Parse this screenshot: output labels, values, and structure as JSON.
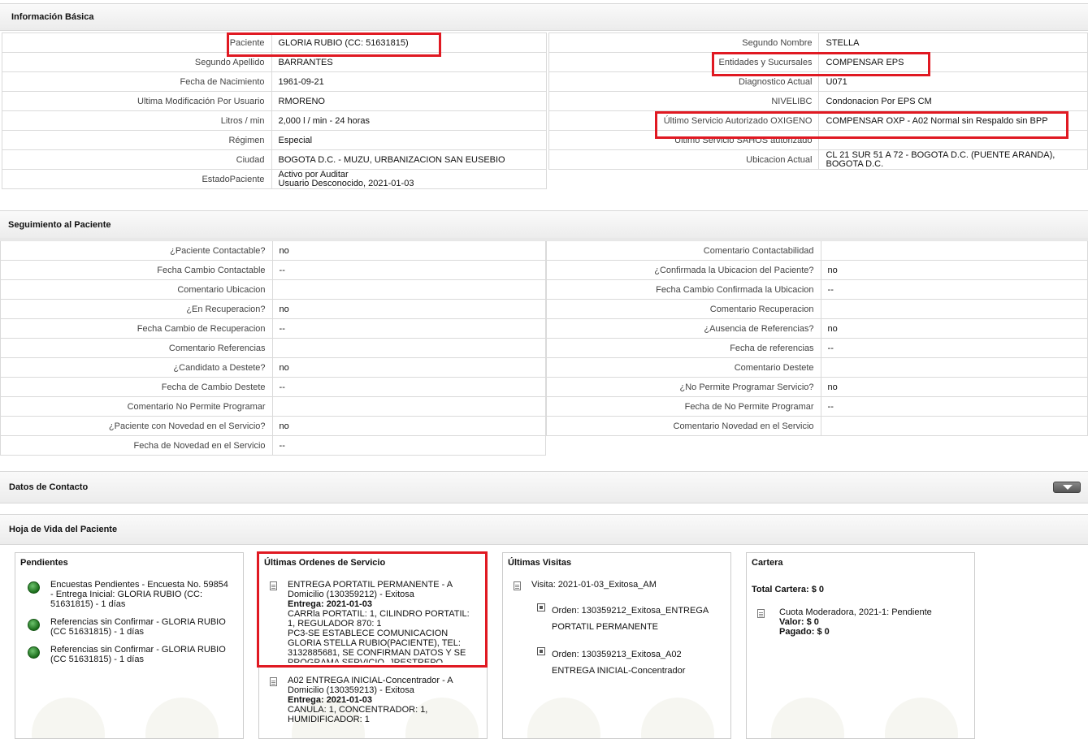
{
  "info_basica": {
    "title": "Información Básica",
    "left": [
      {
        "label": "Paciente",
        "value": "GLORIA RUBIO (CC: 51631815)"
      },
      {
        "label": "Segundo Apellido",
        "value": "BARRANTES"
      },
      {
        "label": "Fecha de Nacimiento",
        "value": "1961-09-21"
      },
      {
        "label": "Ultima Modificación Por Usuario",
        "value": "RMORENO"
      },
      {
        "label": "Litros / min",
        "value": "2,000 l / min - 24 horas"
      },
      {
        "label": "Régimen",
        "value": "Especial"
      },
      {
        "label": "Ciudad",
        "value": "BOGOTA D.C. - MUZU, URBANIZACION SAN EUSEBIO"
      },
      {
        "label": "EstadoPaciente",
        "value_line1": "Activo por Auditar",
        "value_line2": "Usuario Desconocido, 2021-01-03"
      }
    ],
    "right": [
      {
        "label": "Segundo Nombre",
        "value": "STELLA"
      },
      {
        "label": "Entidades y Sucursales",
        "value": "COMPENSAR EPS"
      },
      {
        "label": "Diagnostico Actual",
        "value": "U071"
      },
      {
        "label": "NIVELIBC",
        "value": "Condonacion Por EPS CM"
      },
      {
        "label": "Último Servicio Autorizado OXIGENO",
        "value": "COMPENSAR OXP - A02 Normal sin Respaldo sin BPP"
      },
      {
        "label": "Ultimo Servicio SAHOS autorizado",
        "value": ""
      },
      {
        "label": "Ubicacion Actual",
        "value_line1": "CL 21 SUR 51 A 72 - BOGOTA D.C. (PUENTE ARANDA),",
        "value_line2": "BOGOTA D.C."
      }
    ]
  },
  "seguimiento": {
    "title": "Seguimiento al Paciente",
    "left": [
      {
        "label": "¿Paciente Contactable?",
        "value": "no"
      },
      {
        "label": "Fecha Cambio Contactable",
        "value": "--"
      },
      {
        "label": "Comentario Ubicacion",
        "value": ""
      },
      {
        "label": "¿En Recuperacion?",
        "value": "no"
      },
      {
        "label": "Fecha Cambio de Recuperacion",
        "value": "--"
      },
      {
        "label": "Comentario Referencias",
        "value": ""
      },
      {
        "label": "¿Candidato a Destete?",
        "value": "no"
      },
      {
        "label": "Fecha de Cambio Destete",
        "value": "--"
      },
      {
        "label": "Comentario No Permite Programar",
        "value": ""
      },
      {
        "label": "¿Paciente con Novedad en el Servicio?",
        "value": "no"
      },
      {
        "label": "Fecha de Novedad en el Servicio",
        "value": "--"
      }
    ],
    "right": [
      {
        "label": "Comentario Contactabilidad",
        "value": ""
      },
      {
        "label": "¿Confirmada la Ubicacion del Paciente?",
        "value": "no"
      },
      {
        "label": "Fecha Cambio Confirmada la Ubicacion",
        "value": "--"
      },
      {
        "label": "Comentario Recuperacion",
        "value": ""
      },
      {
        "label": "¿Ausencia de Referencias?",
        "value": "no"
      },
      {
        "label": "Fecha de referencias",
        "value": "--"
      },
      {
        "label": "Comentario Destete",
        "value": ""
      },
      {
        "label": "¿No Permite Programar Servicio?",
        "value": "no"
      },
      {
        "label": "Fecha de No Permite Programar",
        "value": "--"
      },
      {
        "label": "Comentario Novedad en el Servicio",
        "value": ""
      }
    ]
  },
  "datos_contacto": {
    "title": "Datos de Contacto",
    "toggle_icon": "chevron-down-icon"
  },
  "hoja_vida": {
    "title": "Hoja de Vida del Paciente",
    "pendientes": {
      "title": "Pendientes",
      "items": [
        {
          "l1": "Encuestas Pendientes - Encuesta No. 59854",
          "l2": "- Entrega Inicial: GLORIA RUBIO (CC:",
          "l3": "51631815) - 1 días"
        },
        {
          "l1": "Referencias sin Confirmar - GLORIA RUBIO",
          "l2": "(CC 51631815) - 1 días"
        },
        {
          "l1": "Referencias sin Confirmar - GLORIA RUBIO",
          "l2": "(CC 51631815) - 1 días"
        }
      ]
    },
    "ordenes": {
      "title": "Últimas Ordenes de Servicio",
      "items": [
        {
          "l1": "ENTREGA PORTATIL PERMANENTE - A",
          "l2": "Domicilio (130359212) - Exitosa",
          "entrega_label": "Entrega:",
          "entrega_date": "2021-01-03",
          "l3": "CARRla PORTATIL: 1, CILINDRO PORTATIL:",
          "l4": "1, REGULADOR 870: 1",
          "l5": "PC3-SE ESTABLECE COMUNICACION",
          "l6": "GLORIA STELLA RUBIO(PACIENTE), TEL:",
          "l7": "3132885681, SE CONFIRMAN DATOS Y SE",
          "l8": "PROGRAMA SERVICIO. JRESTREPO"
        },
        {
          "l1": "A02 ENTREGA INICIAL-Concentrador - A",
          "l2": "Domicilio (130359213) - Exitosa",
          "entrega_label": "Entrega:",
          "entrega_date": "2021-01-03",
          "l3": "CANULA: 1, CONCENTRADOR: 1,",
          "l4": "HUMIDIFICADOR: 1"
        }
      ]
    },
    "visitas": {
      "title": "Últimas Visitas",
      "visita": "Visita: 2021-01-03_Exitosa_AM",
      "orders": [
        {
          "l1": "Orden: 130359212_Exitosa_ENTREGA",
          "l2": "PORTATIL PERMANENTE"
        },
        {
          "l1": "Orden: 130359213_Exitosa_A02",
          "l2": "ENTREGA INICIAL-Concentrador"
        }
      ]
    },
    "cartera": {
      "title": "Cartera",
      "total": "Total Cartera: $ 0",
      "item": "Cuota Moderadora, 2021-1: Pendiente",
      "valor": "Valor: $ 0",
      "pagado": "Pagado: $ 0"
    }
  },
  "colors": {
    "highlight": "#e01922",
    "status_green": "#1b6d1b"
  }
}
